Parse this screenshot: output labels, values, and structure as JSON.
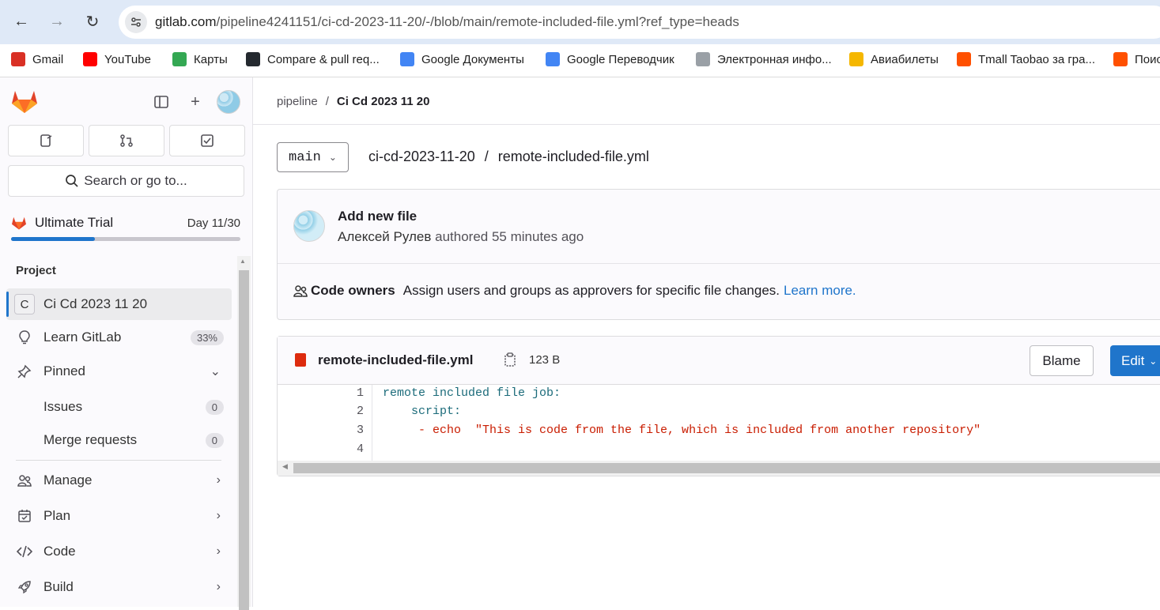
{
  "browser": {
    "url_domain": "gitlab.com",
    "url_path": "/pipeline4241151/ci-cd-2023-11-20/-/blob/main/remote-included-file.yml?ref_type=heads",
    "bookmarks": [
      {
        "label": "Gmail",
        "icon": "gmail-icon",
        "color": "#d93025"
      },
      {
        "label": "YouTube",
        "icon": "youtube-icon",
        "color": "#ff0000"
      },
      {
        "label": "Карты",
        "icon": "maps-icon",
        "color": "#34a853"
      },
      {
        "label": "Compare & pull req...",
        "icon": "github-icon",
        "color": "#24292f"
      },
      {
        "label": "Google Документы",
        "icon": "docs-icon",
        "color": "#4285f4"
      },
      {
        "label": "Google Переводчик",
        "icon": "translate-icon",
        "color": "#4285f4"
      },
      {
        "label": "Электронная инфо...",
        "icon": "globe-icon",
        "color": "#9aa0a6"
      },
      {
        "label": "Авиабилеты",
        "icon": "avia-icon",
        "color": "#f5b700"
      },
      {
        "label": "Tmall Taobao за гра...",
        "icon": "tmall-icon",
        "color": "#ff5000"
      },
      {
        "label": "Поис",
        "icon": "taobao-icon",
        "color": "#ff5000"
      }
    ]
  },
  "sidebar": {
    "search_label": "Search or go to...",
    "trial": {
      "label": "Ultimate Trial",
      "day": "Day 11/30",
      "progress": 0.366
    },
    "section_title": "Project",
    "project": {
      "initial": "C",
      "name": "Ci Cd 2023 11 20"
    },
    "items": [
      {
        "label": "Learn GitLab",
        "badge": "33%"
      },
      {
        "label": "Pinned"
      },
      {
        "label": "Issues",
        "badge": "0"
      },
      {
        "label": "Merge requests",
        "badge": "0"
      },
      {
        "label": "Manage"
      },
      {
        "label": "Plan"
      },
      {
        "label": "Code"
      },
      {
        "label": "Build"
      }
    ]
  },
  "main": {
    "breadcrumb": {
      "group": "pipeline",
      "sep": "/",
      "project": "Ci Cd 2023 11 20"
    },
    "branch": "main",
    "path": {
      "repo": "ci-cd-2023-11-20",
      "sep": "/",
      "file": "remote-included-file.yml"
    },
    "commit": {
      "title": "Add new file",
      "author": "Алексей Рулев",
      "meta": "authored 55 minutes ago"
    },
    "codeowners": {
      "label": "Code owners",
      "text": "Assign users and groups as approvers for specific file changes.",
      "link": "Learn more."
    },
    "file": {
      "name": "remote-included-file.yml",
      "size": "123 B",
      "blame_label": "Blame",
      "edit_label": "Edit",
      "lines": [
        {
          "n": "1",
          "key": "remote included file job:",
          "str": ""
        },
        {
          "n": "2",
          "key": "    script:",
          "str": ""
        },
        {
          "n": "3",
          "key": "",
          "str": "     - echo  \"This is code from the file, which is included from another repository\""
        },
        {
          "n": "4",
          "key": "",
          "str": ""
        }
      ]
    }
  }
}
